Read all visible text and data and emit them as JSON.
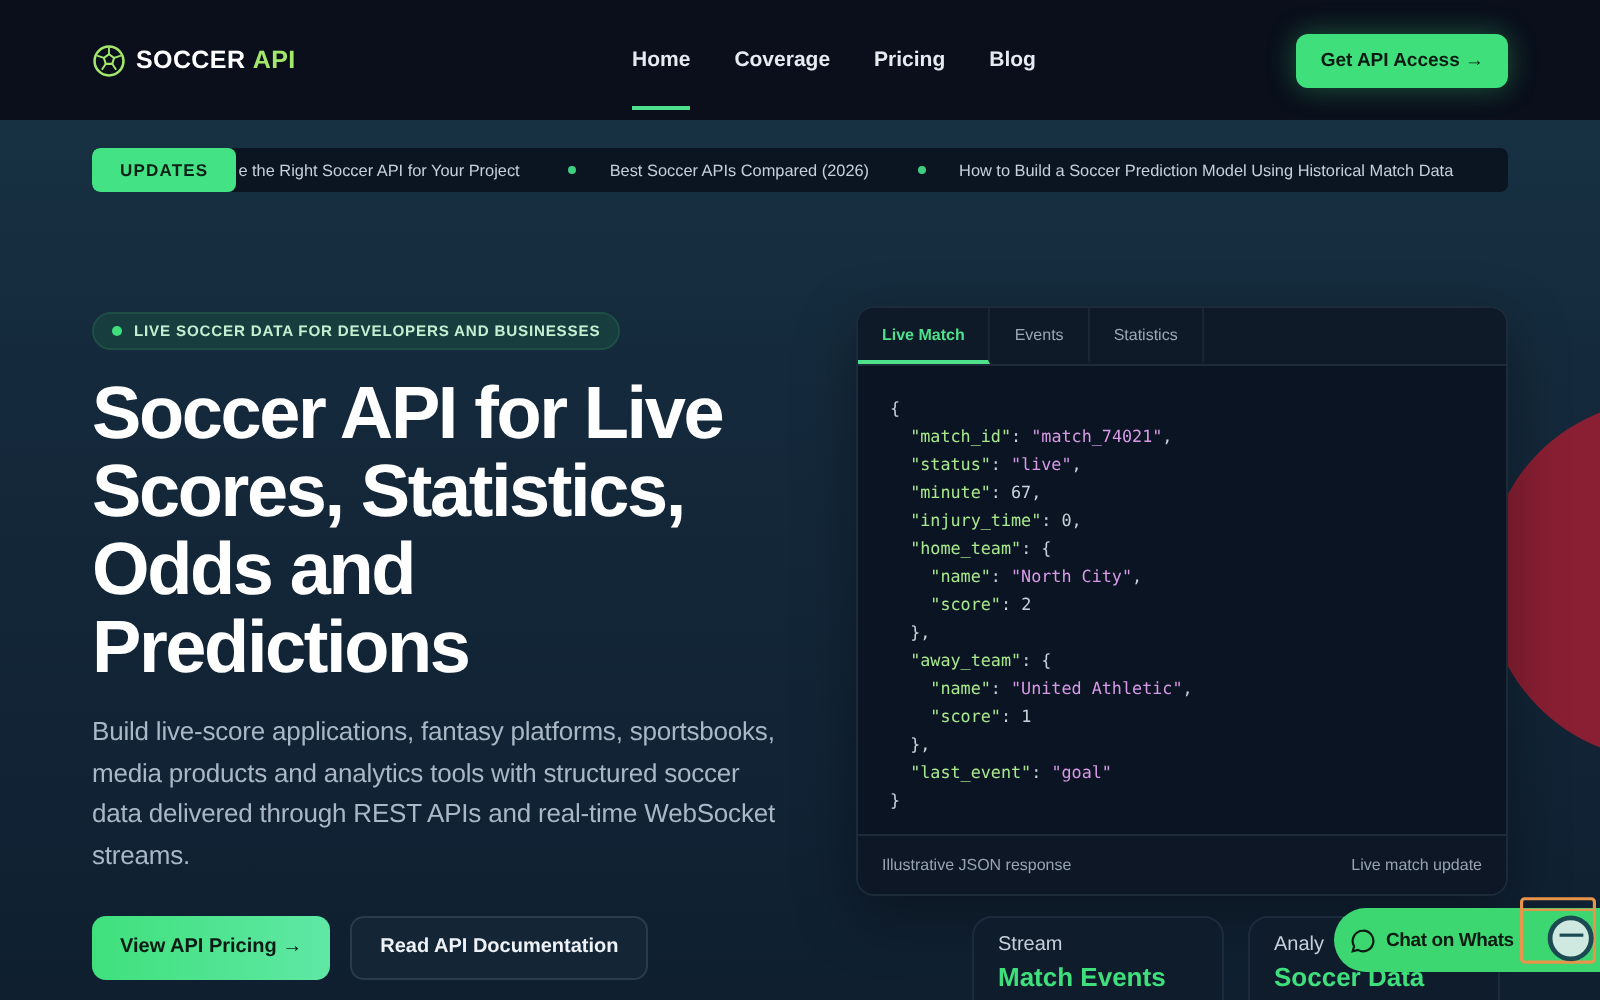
{
  "header": {
    "logo": {
      "word": "SOCCER",
      "accent": "API"
    },
    "nav": [
      {
        "label": "Home",
        "selected": true
      },
      {
        "label": "Coverage",
        "selected": false
      },
      {
        "label": "Pricing",
        "selected": false
      },
      {
        "label": "Blog",
        "selected": false
      }
    ],
    "cta": "Get API Access →"
  },
  "ticker": {
    "badge": "UPDATES",
    "items": [
      "e the Right Soccer API for Your Project",
      "Best Soccer APIs Compared (2026)",
      "How to Build a Soccer Prediction Model Using Historical Match Data"
    ]
  },
  "hero": {
    "eyebrow": "LIVE SOCCER DATA FOR DEVELOPERS AND BUSINESSES",
    "title": "Soccer API for Live Scores, Statistics, Odds and Predictions",
    "description": "Build live-score applications, fantasy platforms, sportsbooks, media products and analytics tools with structured soccer data delivered through REST APIs and real-time WebSocket streams.",
    "buttons": [
      {
        "kind": "primary",
        "label": "View API Pricing →"
      },
      {
        "kind": "secondary",
        "label": "Read API Documentation"
      }
    ]
  },
  "code_panel": {
    "tabs": [
      {
        "label": "Live Match",
        "selected": true
      },
      {
        "label": "Events",
        "selected": false
      },
      {
        "label": "Statistics",
        "selected": false
      }
    ],
    "lines": [
      [
        {
          "kind": "punct",
          "text": "{"
        }
      ],
      [
        {
          "kind": "key",
          "text": "  \"match_id\""
        },
        {
          "kind": "punct",
          "text": ": "
        },
        {
          "kind": "string",
          "text": "\"match_74021\""
        },
        {
          "kind": "punct",
          "text": ","
        }
      ],
      [
        {
          "kind": "key",
          "text": "  \"status\""
        },
        {
          "kind": "punct",
          "text": ": "
        },
        {
          "kind": "string",
          "text": "\"live\""
        },
        {
          "kind": "punct",
          "text": ","
        }
      ],
      [
        {
          "kind": "key",
          "text": "  \"minute\""
        },
        {
          "kind": "punct",
          "text": ": "
        },
        {
          "kind": "number",
          "text": "67"
        },
        {
          "kind": "punct",
          "text": ","
        }
      ],
      [
        {
          "kind": "key",
          "text": "  \"injury_time\""
        },
        {
          "kind": "punct",
          "text": ": "
        },
        {
          "kind": "number",
          "text": "0"
        },
        {
          "kind": "punct",
          "text": ","
        }
      ],
      [
        {
          "kind": "key",
          "text": "  \"home_team\""
        },
        {
          "kind": "punct",
          "text": ": {"
        }
      ],
      [
        {
          "kind": "key",
          "text": "    \"name\""
        },
        {
          "kind": "punct",
          "text": ": "
        },
        {
          "kind": "string",
          "text": "\"North City\""
        },
        {
          "kind": "punct",
          "text": ","
        }
      ],
      [
        {
          "kind": "key",
          "text": "    \"score\""
        },
        {
          "kind": "punct",
          "text": ": "
        },
        {
          "kind": "number",
          "text": "2"
        }
      ],
      [
        {
          "kind": "punct",
          "text": "  },"
        }
      ],
      [
        {
          "kind": "key",
          "text": "  \"away_team\""
        },
        {
          "kind": "punct",
          "text": ": {"
        }
      ],
      [
        {
          "kind": "key",
          "text": "    \"name\""
        },
        {
          "kind": "punct",
          "text": ": "
        },
        {
          "kind": "string",
          "text": "\"United Athletic\""
        },
        {
          "kind": "punct",
          "text": ","
        }
      ],
      [
        {
          "kind": "key",
          "text": "    \"score\""
        },
        {
          "kind": "punct",
          "text": ": "
        },
        {
          "kind": "number",
          "text": "1"
        }
      ],
      [
        {
          "kind": "punct",
          "text": "  },"
        }
      ],
      [
        {
          "kind": "key",
          "text": "  \"last_event\""
        },
        {
          "kind": "punct",
          "text": ": "
        },
        {
          "kind": "string",
          "text": "\"goal\""
        }
      ],
      [
        {
          "kind": "punct",
          "text": "}"
        }
      ]
    ],
    "footer_left": "Illustrative JSON response",
    "footer_right": "Live match update"
  },
  "feature_cards": [
    {
      "label": "Stream",
      "title": "Match Events"
    },
    {
      "label": "Analy",
      "title": "Soccer Data"
    }
  ],
  "chat_button": "Chat on Whats"
}
